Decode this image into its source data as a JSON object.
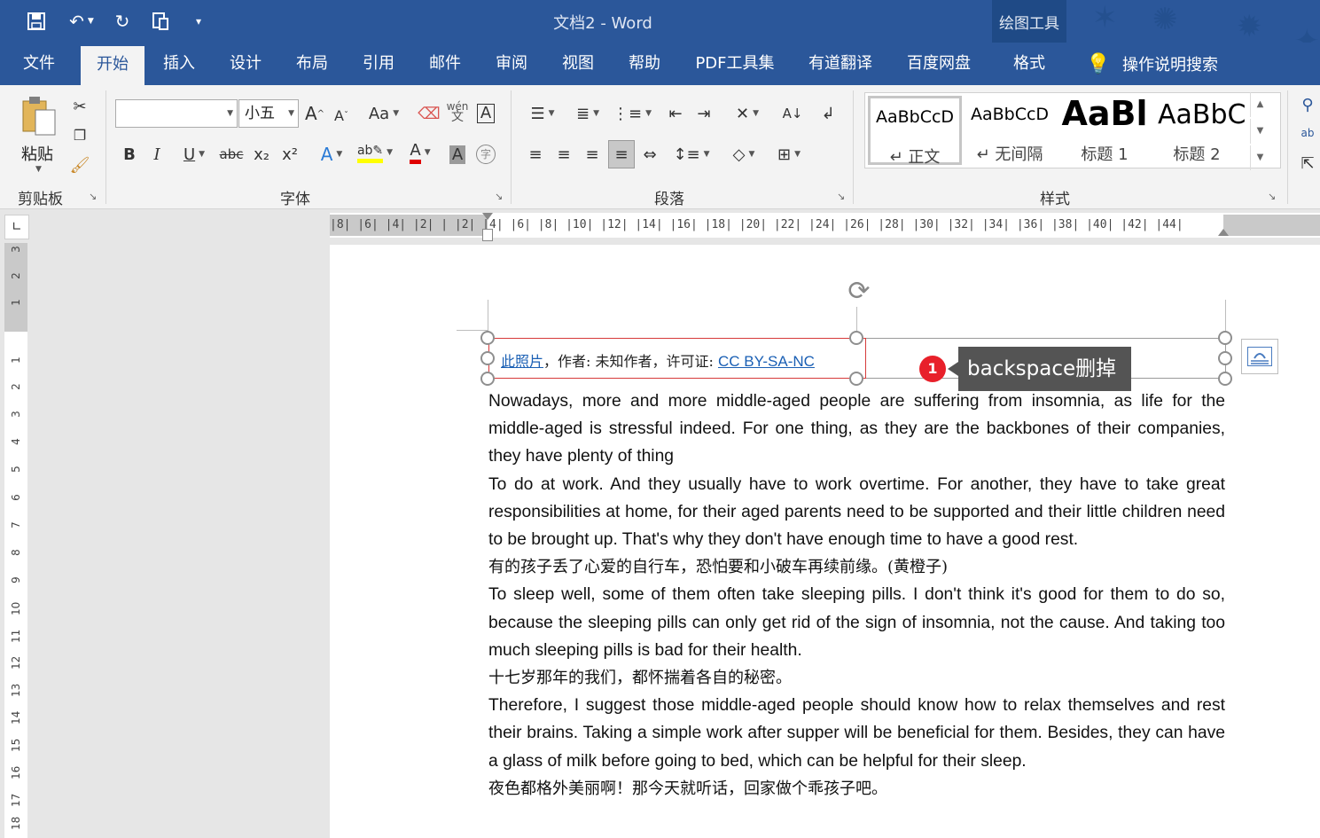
{
  "window": {
    "title": "文档2  -  Word",
    "context_tool": "绘图工具"
  },
  "qat": {
    "save": "💾",
    "undo": "↶",
    "redo": "↻",
    "more": "▾"
  },
  "tabs": [
    {
      "label": "文件"
    },
    {
      "label": "开始"
    },
    {
      "label": "插入"
    },
    {
      "label": "设计"
    },
    {
      "label": "布局"
    },
    {
      "label": "引用"
    },
    {
      "label": "邮件"
    },
    {
      "label": "审阅"
    },
    {
      "label": "视图"
    },
    {
      "label": "帮助"
    },
    {
      "label": "PDF工具集"
    },
    {
      "label": "有道翻译"
    },
    {
      "label": "百度网盘"
    },
    {
      "label": "格式"
    }
  ],
  "tell_me": "操作说明搜索",
  "ribbon": {
    "clipboard": {
      "label": "剪贴板",
      "paste": "粘贴"
    },
    "font": {
      "label": "字体",
      "font_name": "",
      "font_size": "小五",
      "grow": "A",
      "shrink": "A",
      "change_case": "Aa",
      "pinyin": "wén",
      "bold": "B",
      "italic": "I",
      "underline": "U",
      "strike": "abc",
      "subscript": "x₂",
      "superscript": "x²"
    },
    "paragraph": {
      "label": "段落"
    },
    "styles": {
      "label": "样式",
      "items": [
        {
          "sample": "AaBbCcD",
          "name": "↵ 正文"
        },
        {
          "sample": "AaBbCcD",
          "name": "↵ 无间隔"
        },
        {
          "sample": "AaBl",
          "name": "标题 1"
        },
        {
          "sample": "AaBbC",
          "name": "标题 2"
        }
      ]
    }
  },
  "ruler": {
    "ticks": "|8|  |6|  |4|  |2|  |  |2|  |4|  |6|  |8|  |10| |12| |14| |16| |18| |20| |22| |24| |26| |28| |30| |32| |34| |36| |38| |40| |42| |44|",
    "vertical_numbers": [
      "3",
      "2",
      "1",
      "",
      "1",
      "2",
      "3",
      "4",
      "5",
      "6",
      "7",
      "8",
      "9",
      "10",
      "11",
      "12",
      "13",
      "14",
      "15",
      "16",
      "17",
      "18"
    ]
  },
  "caption": {
    "link1": "此照片",
    "middle": "，作者: 未知作者，许可证: ",
    "link2": "CC BY-SA-NC"
  },
  "callout": {
    "number": "1",
    "text": "backspace删掉"
  },
  "document": {
    "paragraphs": [
      {
        "lang": "en",
        "text": "Nowadays, more and more middle-aged people are suffering from insomnia, as life for the middle-aged is stressful indeed. For one thing, as they are the backbones of their companies, they have plenty of thing"
      },
      {
        "lang": "en",
        "text": "To do at work. And they usually have to work overtime. For another, they have to take great responsibilities at home, for their aged parents need to be supported and their little children need to be brought up. That's why they don't have enough time to have a good rest."
      },
      {
        "lang": "zh",
        "text": "有的孩子丢了心爱的自行车，恐怕要和小破车再续前缘。(黄橙子)"
      },
      {
        "lang": "en",
        "text": "To sleep well, some of them often take sleeping pills. I don't think it's good for them to do so, because the sleeping pills can only get rid of the sign of insomnia, not the cause. And taking too much sleeping pills is bad for their health."
      },
      {
        "lang": "zh",
        "text": "十七岁那年的我们，都怀揣着各自的秘密。"
      },
      {
        "lang": "en",
        "text": "Therefore, I suggest those middle-aged people should know how to relax themselves and rest their brains. Taking a simple work after supper will be beneficial for them. Besides, they can have a glass of milk before going to bed, which can be helpful for their sleep."
      },
      {
        "lang": "zh",
        "text": "夜色都格外美丽啊！那今天就听话，回家做个乖孩子吧。"
      }
    ]
  }
}
